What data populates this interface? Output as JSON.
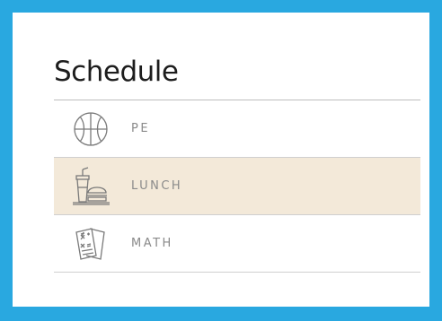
{
  "schedule": {
    "title": "Schedule",
    "items": [
      {
        "label": "PE",
        "icon": "basketball-icon",
        "selected": false
      },
      {
        "label": "LUNCH",
        "icon": "lunch-tray-icon",
        "selected": true
      },
      {
        "label": "MATH",
        "icon": "math-worksheet-icon",
        "selected": false
      }
    ]
  },
  "colors": {
    "frame": "#29a8e0",
    "card": "#ffffff",
    "selected_row": "#f3e9d9",
    "label_text": "#8a8a8a",
    "title_text": "#1d1d1d",
    "icon_stroke": "#7a7a7a"
  }
}
